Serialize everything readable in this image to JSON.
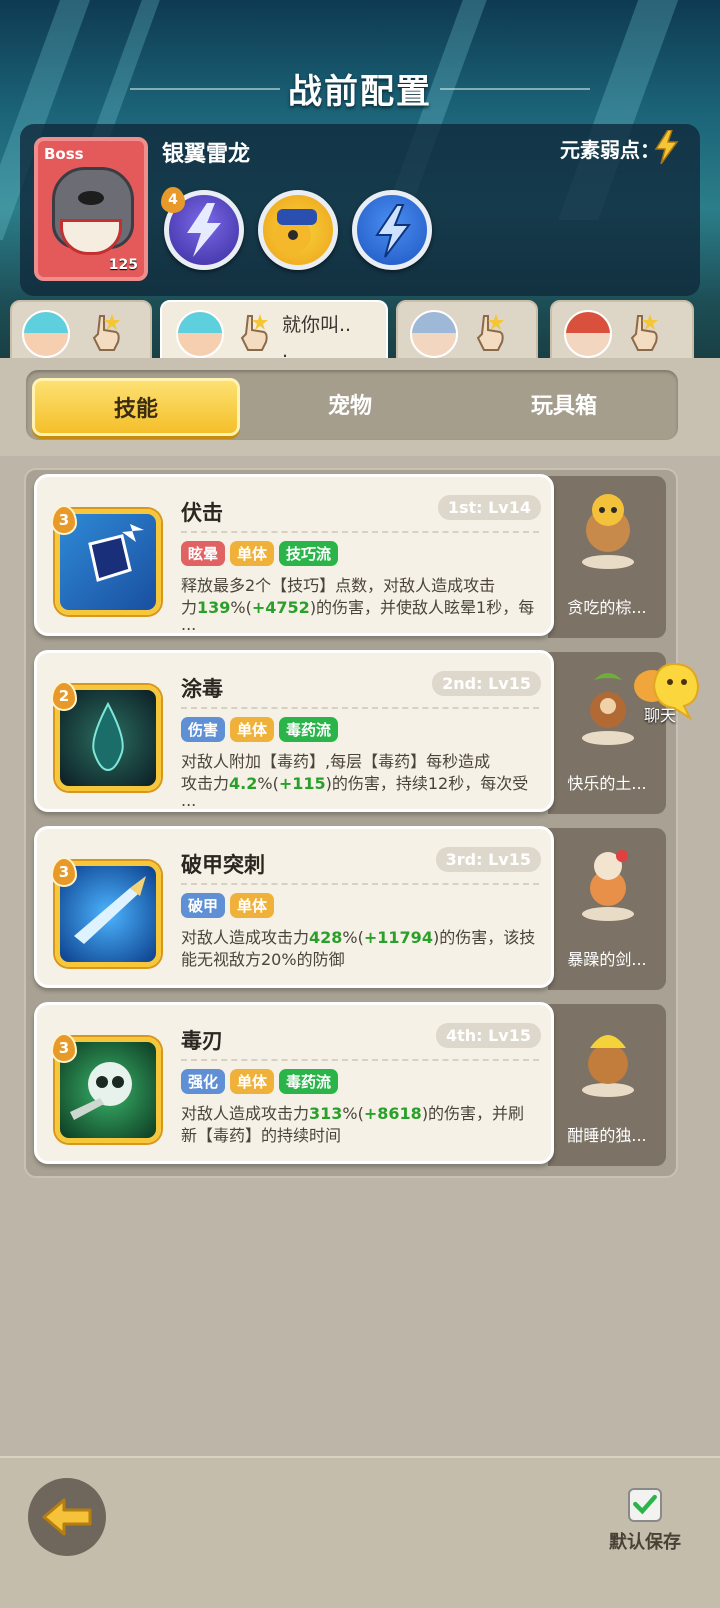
{
  "header": {
    "title": "战前配置"
  },
  "boss": {
    "badge": "Boss",
    "level": "125",
    "name": "银翼雷龙",
    "weakness_label": "元素弱点：",
    "weakness_icon": "lightning-icon",
    "skill_badge": "4"
  },
  "hero_tabs": [
    {
      "name": "",
      "active": false
    },
    {
      "name": "就你叫..\n.",
      "active": true
    },
    {
      "name": "",
      "active": false
    },
    {
      "name": "",
      "active": false
    }
  ],
  "segments": [
    "技能",
    "宠物",
    "玩具箱"
  ],
  "skills": [
    {
      "badge": "3",
      "name": "伏击",
      "level": "1st: Lv14",
      "tags": [
        {
          "t": "眩晕",
          "c": "#e06262"
        },
        {
          "t": "单体",
          "c": "#f0b13a"
        },
        {
          "t": "技巧流",
          "c": "#2bb44a"
        }
      ],
      "d1": "释放最多2个【技巧】点数，对敌人造成攻击",
      "d2a": "力",
      "d2b": "139",
      "d2c": "%(",
      "d2d": "+4752",
      "d2e": ")的伤害，并使敌人眩晕1秒，每",
      "d3": "...",
      "pet": "贪吃的棕..."
    },
    {
      "badge": "2",
      "name": "涂毒",
      "level": "2nd: Lv15",
      "tags": [
        {
          "t": "伤害",
          "c": "#5f8fd4"
        },
        {
          "t": "单体",
          "c": "#f0b13a"
        },
        {
          "t": "毒药流",
          "c": "#2bb44a"
        }
      ],
      "d1": "对敌人附加【毒药】,每层【毒药】每秒造成",
      "d2a": "攻击力",
      "d2b": "4.2",
      "d2c": "%(",
      "d2d": "+115",
      "d2e": ")的伤害，持续12秒，每次受",
      "d3": "...",
      "pet": "快乐的土..."
    },
    {
      "badge": "3",
      "name": "破甲突刺",
      "level": "3rd: Lv15",
      "tags": [
        {
          "t": "破甲",
          "c": "#5f8fd4"
        },
        {
          "t": "单体",
          "c": "#f0b13a"
        }
      ],
      "d1a": "对敌人造成攻击力",
      "d1b": "428",
      "d1c": "%(",
      "d1d": "+11794",
      "d1e": ")的伤害，该技",
      "d2": "能无视敌方20%的防御",
      "pet": "暴躁的剑..."
    },
    {
      "badge": "3",
      "name": "毒刃",
      "level": "4th: Lv15",
      "tags": [
        {
          "t": "强化",
          "c": "#5f8fd4"
        },
        {
          "t": "单体",
          "c": "#f0b13a"
        },
        {
          "t": "毒药流",
          "c": "#2bb44a"
        }
      ],
      "d1a": "对敌人造成攻击力",
      "d1b": "313",
      "d1c": "%(",
      "d1d": "+8618",
      "d1e": ")的伤害，并刷",
      "d2": "新【毒药】的持续时间",
      "pet": "酣睡的独..."
    }
  ],
  "chat": {
    "label": "聊天"
  },
  "footer": {
    "save_label": "默认保存",
    "back_icon": "back-arrow-icon",
    "check_icon": "checkmark-icon"
  }
}
